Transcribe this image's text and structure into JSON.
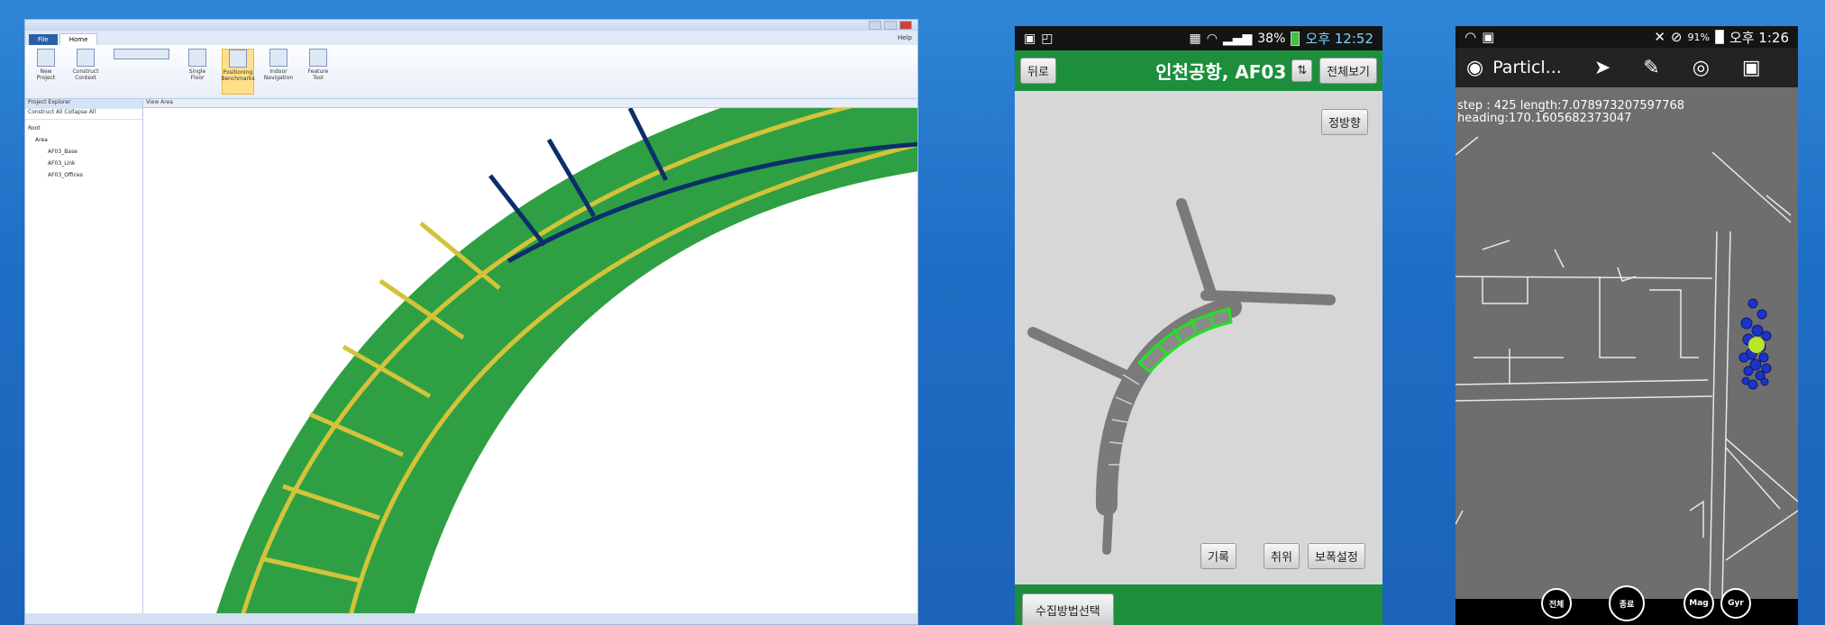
{
  "desktop": {
    "title": "",
    "file_tab": "File",
    "home_tab": "Home",
    "help": "Help",
    "ribbon_buttons": [
      "New Project",
      "Construct Context",
      "",
      "Single Floor",
      "Positioning Benchmarks",
      "Indoor Navigation",
      "Feature Tool"
    ],
    "tree_header": "Project Explorer",
    "tree_toolbar": "Construct All  Collapse All",
    "tree_items": [
      "Root",
      "Area",
      "AF03_Base",
      "AF03_Link",
      "AF03_Offices"
    ],
    "view_header": "View Area",
    "colors": {
      "corridor": "#2ea043",
      "grid_edge": "#d4c33a",
      "grid_edge_dark": "#0b2f6b"
    }
  },
  "phone1": {
    "status": {
      "battery": "38%",
      "time": "오후 12:52"
    },
    "back_button": "뒤로",
    "title": "인천공항, AF03",
    "show_all_button": "전체보기",
    "heading_button": "정방향",
    "record_button": "기록",
    "undo_button": "취위",
    "step_setting_button": "보폭설정",
    "collect_method_button": "수집방법선택",
    "colors": {
      "bar": "#1c8e3c",
      "highlight": "#25e025"
    }
  },
  "phone2": {
    "status": {
      "battery": "91%",
      "time": "오후 1:26"
    },
    "app_title": "Particl...",
    "step_line": "step : 425 length:7.078973207597768",
    "heading_line": "heading:170.1605682373047",
    "buttons": [
      "전체",
      "종료",
      "Mag",
      "Gyr"
    ],
    "colors": {
      "particle": "#1c34c8",
      "current": "#b6e627"
    }
  }
}
